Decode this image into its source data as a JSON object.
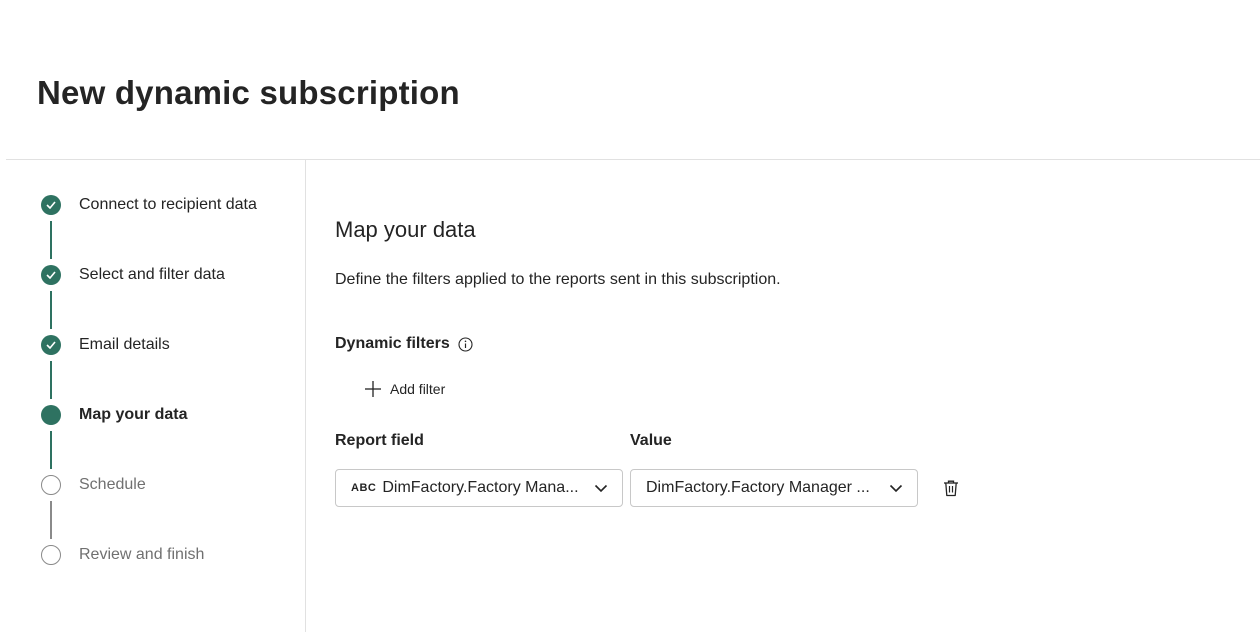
{
  "page": {
    "title": "New dynamic subscription"
  },
  "stepper": {
    "steps": [
      {
        "label": "Connect to recipient data",
        "state": "done"
      },
      {
        "label": "Select and filter data",
        "state": "done"
      },
      {
        "label": "Email details",
        "state": "done"
      },
      {
        "label": "Map your data",
        "state": "current"
      },
      {
        "label": "Schedule",
        "state": "todo"
      },
      {
        "label": "Review and finish",
        "state": "todo"
      }
    ]
  },
  "main": {
    "title": "Map your data",
    "description": "Define the filters applied to the reports sent in this subscription.",
    "dynamic_filters": {
      "heading": "Dynamic filters",
      "add_filter_label": "Add filter",
      "columns": {
        "report_field": "Report field",
        "value": "Value"
      },
      "rows": [
        {
          "type_icon": "ABC",
          "report_field": "DimFactory.Factory Mana...",
          "value": "DimFactory.Factory Manager ..."
        }
      ]
    }
  },
  "colors": {
    "accent": "#2e7261",
    "border": "#c8c8c8",
    "divider": "#e1e1e1"
  }
}
